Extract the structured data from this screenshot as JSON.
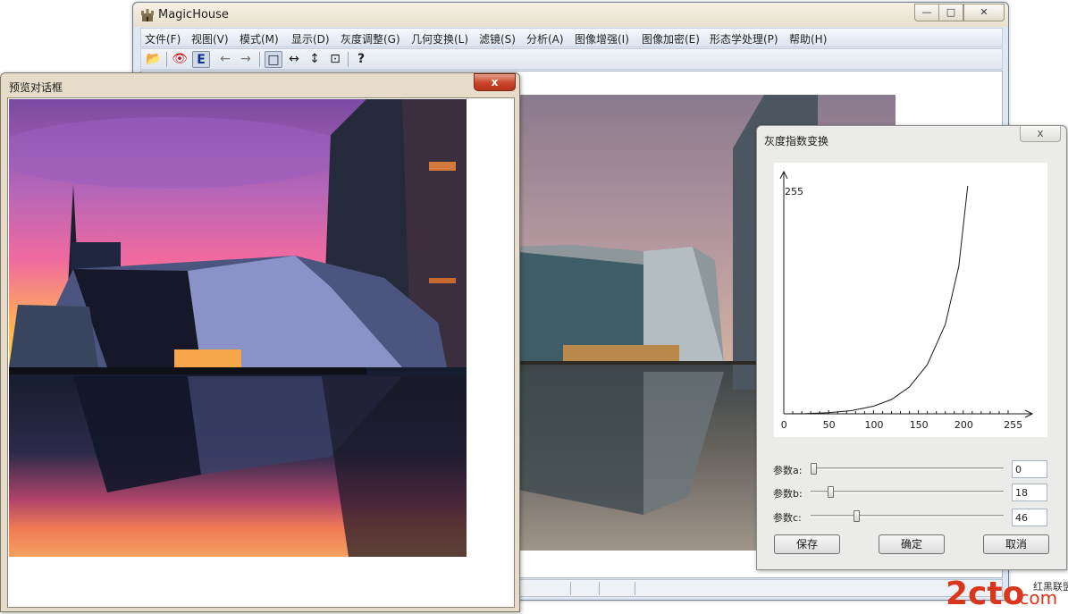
{
  "main_window": {
    "title": "MagicHouse",
    "caption_buttons": {
      "minimize": "—",
      "maximize": "□",
      "close": "✕"
    },
    "menu": [
      "文件(F)",
      "视图(V)",
      "模式(M)",
      "显示(D)",
      "灰度调整(G)",
      "几何变换(L)",
      "滤镜(S)",
      "分析(A)",
      "图像增强(I)",
      "图像加密(E)",
      "形态学处理(P)",
      "帮助(H)"
    ],
    "toolbar": [
      {
        "name": "open-icon",
        "glyph": "📂"
      },
      {
        "name": "eye-icon",
        "glyph": "👁"
      },
      {
        "name": "e-mode-icon",
        "glyph": "E"
      },
      {
        "name": "arrow-left-icon",
        "glyph": "←"
      },
      {
        "name": "arrow-right-icon",
        "glyph": "→"
      },
      {
        "name": "select-rect-icon",
        "glyph": "□"
      },
      {
        "name": "fit-width-icon",
        "glyph": "↔"
      },
      {
        "name": "fit-height-icon",
        "glyph": "↕"
      },
      {
        "name": "fit-window-icon",
        "glyph": "⊡"
      },
      {
        "name": "help-icon",
        "glyph": "?"
      }
    ]
  },
  "preview_dialog": {
    "title": "预览对话框",
    "close_glyph": "x"
  },
  "transform_dialog": {
    "title": "灰度指数变换",
    "close_glyph": "x",
    "chart_data": {
      "type": "line",
      "title": "",
      "xlabel": "",
      "ylabel": "",
      "x_ticks": [
        "0",
        "50",
        "100",
        "150",
        "200",
        "255"
      ],
      "y_tick_label": "255",
      "xlim": [
        0,
        255
      ],
      "ylim": [
        0,
        255
      ],
      "x": [
        0,
        25,
        50,
        75,
        100,
        120,
        140,
        160,
        180,
        195,
        205
      ],
      "values": [
        0,
        0.3,
        1.2,
        3.5,
        8.5,
        16,
        30,
        55,
        100,
        165,
        255
      ]
    },
    "params": [
      {
        "label": "参数a:",
        "value": "0",
        "position": 0.0
      },
      {
        "label": "参数b:",
        "value": "18",
        "position": 0.09
      },
      {
        "label": "参数c:",
        "value": "46",
        "position": 0.23
      }
    ],
    "buttons": {
      "save": "保存",
      "ok": "确定",
      "cancel": "取消"
    }
  },
  "watermark": {
    "text": "2cto",
    "suffix": ".com",
    "cn": "红黑联盟"
  }
}
